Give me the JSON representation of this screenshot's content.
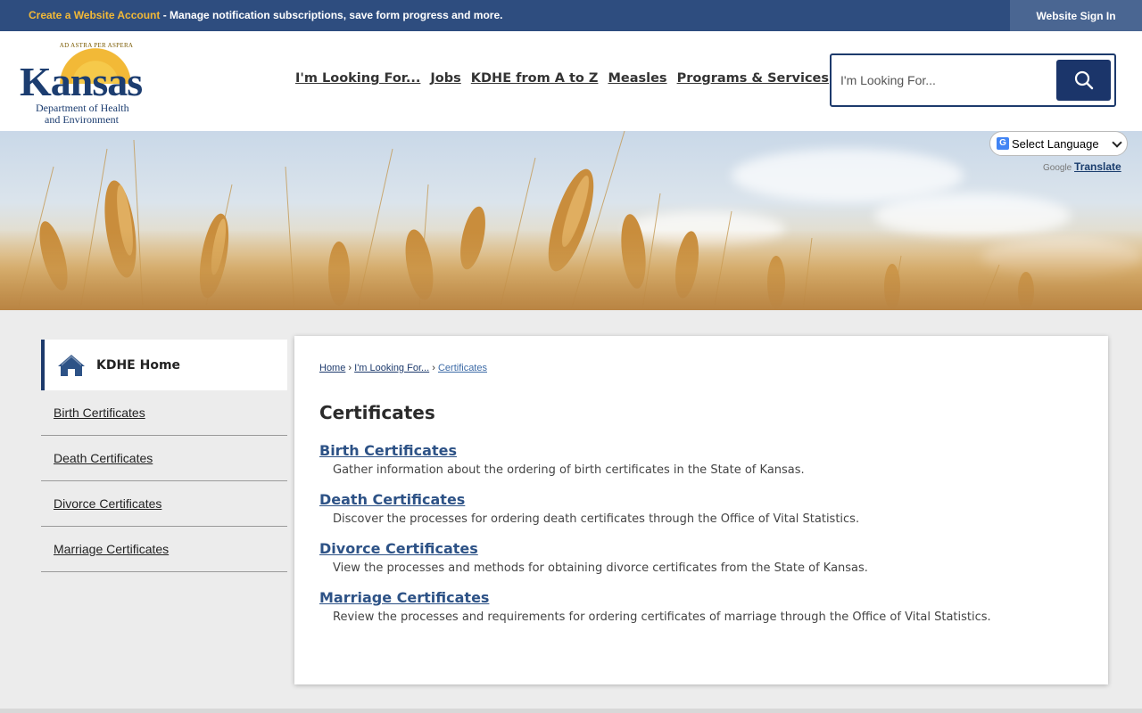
{
  "topbar": {
    "create_link": "Create a Website Account",
    "message": " - Manage notification subscriptions, save form progress and more.",
    "signin_label": "Website Sign In"
  },
  "logo": {
    "motto": "AD ASTRA PER ASPERA",
    "word": "Kansas",
    "sub1": "Department of Health",
    "sub2": "and Environment"
  },
  "nav": {
    "items": [
      "I'm Looking For...",
      "Jobs",
      "KDHE from A to Z",
      "Measles",
      "Programs & Services"
    ]
  },
  "search": {
    "placeholder": "I'm Looking For...",
    "icon": "search-icon"
  },
  "translate": {
    "select_label": "Select Language",
    "powered_prefix": "Google",
    "translate_label": "Translate"
  },
  "sidebar": {
    "home_label": "KDHE Home",
    "items": [
      {
        "label": "Birth Certificates"
      },
      {
        "label": "Death Certificates"
      },
      {
        "label": "Divorce Certificates"
      },
      {
        "label": "Marriage Certificates"
      }
    ]
  },
  "breadcrumb": {
    "home": "Home",
    "parent": "I'm Looking For...",
    "current": "Certificates",
    "separator": "›"
  },
  "main": {
    "title": "Certificates",
    "items": [
      {
        "title": "Birth Certificates",
        "desc": "Gather information about the ordering of birth certificates in the State of Kansas."
      },
      {
        "title": "Death Certificates",
        "desc": "Discover the processes for ordering death certificates through the Office of Vital Statistics."
      },
      {
        "title": "Divorce Certificates",
        "desc": "View the processes and methods for obtaining divorce certificates from the State of Kansas."
      },
      {
        "title": "Marriage Certificates",
        "desc": "Review the processes and requirements for ordering certificates of marriage through the Office of Vital Statistics."
      }
    ]
  },
  "colors": {
    "topbar": "#2e4d7f",
    "accent_gold": "#f2b937",
    "navy": "#1b356a",
    "link": "#2d5286"
  }
}
